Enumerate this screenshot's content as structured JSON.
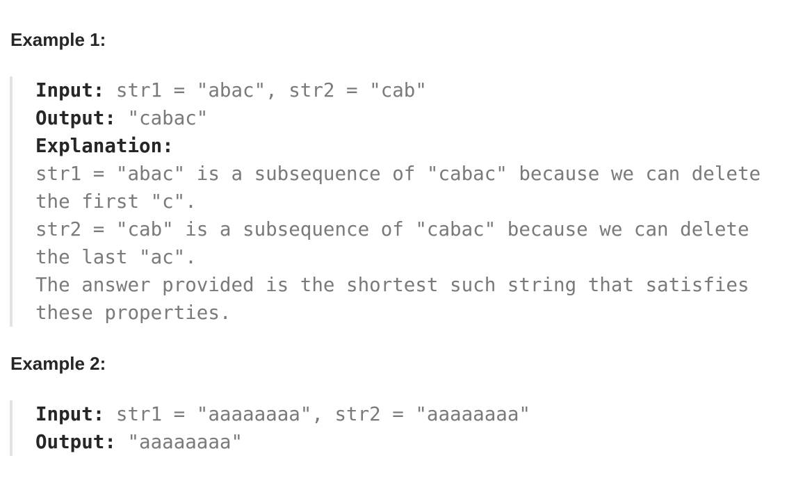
{
  "example1": {
    "heading": "Example 1:",
    "input_label": "Input:",
    "input_value": " str1 = \"abac\", str2 = \"cab\"",
    "output_label": "Output:",
    "output_value": " \"cabac\"",
    "explanation_label": "Explanation:",
    "explanation_lines": [
      "str1 = \"abac\" is a subsequence of \"cabac\" because we can delete",
      "the first \"c\".",
      "str2 = \"cab\" is a subsequence of \"cabac\" because we can delete",
      "the last \"ac\".",
      "The answer provided is the shortest such string that satisfies",
      "these properties."
    ]
  },
  "example2": {
    "heading": "Example 2:",
    "input_label": "Input:",
    "input_value": " str1 = \"aaaaaaaa\", str2 = \"aaaaaaaa\"",
    "output_label": "Output:",
    "output_value": " \"aaaaaaaa\""
  }
}
